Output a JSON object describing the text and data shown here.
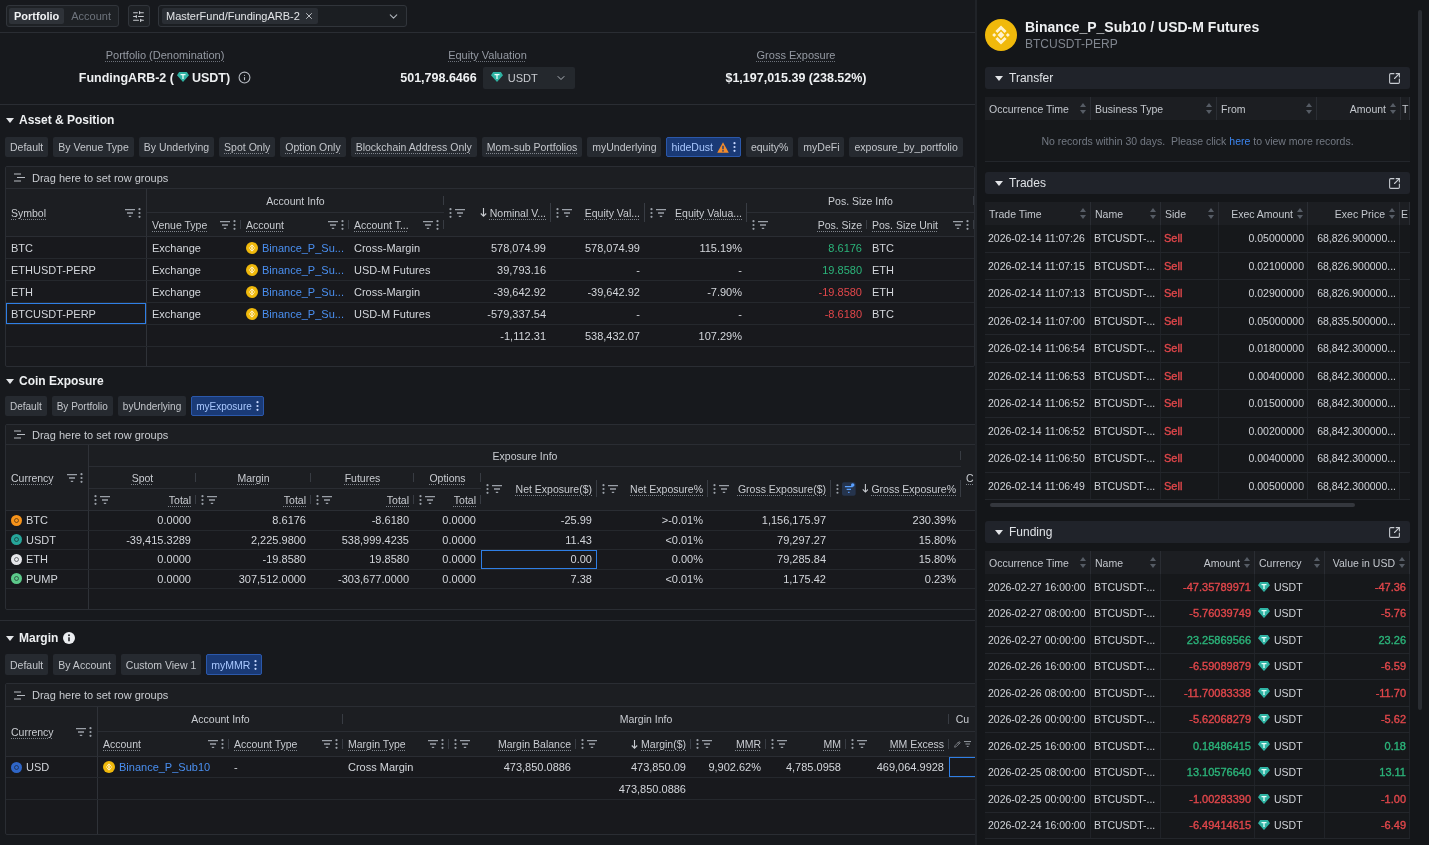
{
  "top_bar": {
    "scope_tabs": [
      {
        "label": "Portfolio",
        "selected": true
      },
      {
        "label": "Account",
        "selected": false
      }
    ],
    "portfolio_chips": [
      "MasterFund/FundingARB-2"
    ]
  },
  "summary": [
    {
      "kind": "denomination",
      "label": "Portfolio (Denomination)",
      "value": "FundingARB-2 (",
      "currency": "USDT)"
    },
    {
      "kind": "valuation",
      "label": "Equity Valuation",
      "value": "501,798.6466",
      "currency": "USDT"
    },
    {
      "kind": "plain",
      "label": "Gross Exposure",
      "value": "$1,197,015.39 (238.52%)"
    }
  ],
  "sections": [
    {
      "title": "Asset & Position",
      "expanded": true,
      "views": [
        {
          "label": "Default",
          "selected": false,
          "hint": false,
          "warning": false
        },
        {
          "label": "By Venue Type",
          "selected": false,
          "hint": false,
          "warning": false
        },
        {
          "label": "By Underlying",
          "selected": false,
          "hint": false,
          "warning": false
        },
        {
          "label": "Spot Only",
          "selected": false,
          "hint": true,
          "warning": false
        },
        {
          "label": "Option Only",
          "selected": false,
          "hint": true,
          "warning": false
        },
        {
          "label": "Blockchain Address Only",
          "selected": false,
          "hint": true,
          "warning": false
        },
        {
          "label": "Mom-sub Portfolios",
          "selected": false,
          "hint": true,
          "warning": false
        },
        {
          "label": "myUnderlying",
          "selected": false,
          "hint": false,
          "warning": false
        },
        {
          "label": "hideDust",
          "selected": true,
          "hint": false,
          "warning": true
        },
        {
          "label": "equity%",
          "selected": false,
          "hint": false,
          "warning": false
        },
        {
          "label": "myDeFi",
          "selected": false,
          "hint": false,
          "warning": false
        },
        {
          "label": "exposure_by_portfolio",
          "selected": false,
          "hint": false,
          "warning": false
        }
      ],
      "grid": {
        "group_bar": "Drag here to set row groups",
        "header": [
          {
            "label": "Symbol",
            "kind": "text"
          },
          {
            "label": "Account Info",
            "children": [
              {
                "label": "Venue Type",
                "kind": "text"
              },
              {
                "label": "Account",
                "kind": "text"
              },
              {
                "label": "Account T...",
                "kind": "text"
              }
            ]
          },
          {
            "label": "Nominal V...",
            "kind": "number",
            "sort_descending": true,
            "total": "-1,112.31"
          },
          {
            "label": "Equity Val...",
            "kind": "number",
            "total": "538,432.07"
          },
          {
            "label": "Equity Valua...",
            "kind": "number",
            "total": "107.29%"
          },
          {
            "label": "Pos. Size Info",
            "children": [
              {
                "label": "Pos. Size",
                "kind": "number"
              },
              {
                "label": "Pos. Size Unit",
                "kind": "text"
              }
            ]
          }
        ],
        "rows": [
          [
            "BTC",
            "Exchange",
            {
              "text": "Binance_P_Su...",
              "kind": "account"
            },
            "Cross-Margin",
            "578,074.99",
            "578,074.99",
            "115.19%",
            {
              "text": "8.6176",
              "color": "#2bb47a"
            },
            "BTC"
          ],
          [
            "ETHUSDT-PERP",
            "Exchange",
            {
              "text": "Binance_P_Su...",
              "kind": "account"
            },
            "USD-M Futures",
            "39,793.16",
            "-",
            "-",
            {
              "text": "19.8580",
              "color": "#2bb47a"
            },
            "ETH"
          ],
          [
            "ETH",
            "Exchange",
            {
              "text": "Binance_P_Su...",
              "kind": "account"
            },
            "Cross-Margin",
            "-39,642.92",
            "-39,642.92",
            "-7.90%",
            {
              "text": "-19.8580",
              "color": "#e2474b"
            },
            "ETH"
          ],
          [
            {
              "text": "BTCUSDT-PERP",
              "focused": true
            },
            "Exchange",
            {
              "text": "Binance_P_Su...",
              "kind": "account"
            },
            "USD-M Futures",
            "-579,337.54",
            "-",
            "-",
            {
              "text": "-8.6180",
              "color": "#e2474b"
            },
            "BTC"
          ]
        ]
      }
    },
    {
      "title": "Coin Exposure",
      "expanded": true,
      "views": [
        {
          "label": "Default",
          "selected": false,
          "hint": false,
          "warning": false
        },
        {
          "label": "By Portfolio",
          "selected": false,
          "hint": false,
          "warning": false
        },
        {
          "label": "byUnderlying",
          "selected": false,
          "hint": false,
          "warning": false
        },
        {
          "label": "myExposure",
          "selected": true,
          "hint": false,
          "warning": false
        }
      ],
      "grid": {
        "group_bar": "Drag here to set row groups",
        "header": [
          {
            "label": "Currency",
            "kind": "text"
          },
          {
            "label": "Exposure Info",
            "children": [
              {
                "label": "Spot",
                "hint": true,
                "children": [
                  {
                    "label": "Total",
                    "kind": "number"
                  }
                ]
              },
              {
                "label": "Margin",
                "hint": true,
                "children": [
                  {
                    "label": "Total",
                    "kind": "number"
                  }
                ]
              },
              {
                "label": "Futures",
                "hint": true,
                "children": [
                  {
                    "label": "Total",
                    "kind": "number"
                  }
                ]
              },
              {
                "label": "Options",
                "hint": true,
                "children": [
                  {
                    "label": "Total",
                    "kind": "number"
                  }
                ]
              },
              {
                "label": "Net Exposure($)",
                "kind": "number"
              },
              {
                "label": "Net Exposure%",
                "kind": "number"
              },
              {
                "label": "Gross Exposure($)",
                "kind": "number"
              },
              {
                "label": "Gross Exposure%",
                "kind": "number",
                "sort_descending": true,
                "filtered": true
              }
            ]
          },
          {
            "label": "C",
            "kind": "cut"
          }
        ],
        "rows": [
          [
            {
              "text": "BTC",
              "kind": "coin",
              "color": "#f7931a"
            },
            "0.0000",
            "8.6176",
            "-8.6180",
            "0.0000",
            "-25.99",
            ">-0.01%",
            "1,156,175.97",
            "230.39%"
          ],
          [
            {
              "text": "USDT",
              "kind": "coin",
              "color": "#26a69a"
            },
            "-39,415.3289",
            "2,225.9800",
            "538,999.4235",
            "0.0000",
            "11.43",
            "<0.01%",
            "79,297.27",
            "15.80%"
          ],
          [
            {
              "text": "ETH",
              "kind": "coin",
              "color": "#e6e7ea"
            },
            "0.0000",
            "-19.8580",
            "19.8580",
            "0.0000",
            {
              "text": "0.00",
              "focused": true
            },
            "0.00%",
            "79,285.84",
            "15.80%"
          ],
          [
            {
              "text": "PUMP",
              "kind": "coin",
              "color": "#5cc98a"
            },
            "0.0000",
            "307,512.0000",
            "-303,677.0000",
            "0.0000",
            "7.38",
            "<0.01%",
            "1,175.42",
            "0.23%"
          ]
        ]
      }
    },
    {
      "title": "Margin",
      "expanded": true,
      "info": true,
      "views": [
        {
          "label": "Default",
          "selected": false,
          "hint": false,
          "warning": false
        },
        {
          "label": "By Account",
          "selected": false,
          "hint": false,
          "warning": false
        },
        {
          "label": "Custom View 1",
          "selected": false,
          "hint": false,
          "warning": false
        },
        {
          "label": "myMMR",
          "selected": true,
          "hint": false,
          "warning": false
        }
      ],
      "grid": {
        "group_bar": "Drag here to set row groups",
        "header": [
          {
            "label": "Currency",
            "kind": "text"
          },
          {
            "label": "Account Info",
            "children": [
              {
                "label": "Account",
                "kind": "text"
              },
              {
                "label": "Account Type",
                "kind": "text"
              }
            ]
          },
          {
            "label": "Margin Info",
            "children": [
              {
                "label": "Margin Type",
                "kind": "text"
              },
              {
                "label": "Margin Balance",
                "kind": "number"
              },
              {
                "label": "Margin($)",
                "kind": "number",
                "sort_descending": true,
                "total": "473,850.0886"
              },
              {
                "label": "MMR",
                "kind": "number"
              },
              {
                "label": "MM",
                "kind": "number"
              },
              {
                "label": "MM Excess",
                "kind": "number"
              }
            ]
          },
          {
            "label": "Cu",
            "children": [
              {
                "kind": "edit"
              }
            ]
          }
        ],
        "rows": [
          [
            {
              "text": "USD",
              "kind": "coin",
              "color": "#2f66c8"
            },
            {
              "text": "Binance_P_Sub10",
              "kind": "account"
            },
            "-",
            "Cross Margin",
            "473,850.0886",
            "473,850.09",
            "9,902.62%",
            "4,785.0958",
            "469,064.9928",
            {
              "focused": true
            }
          ]
        ]
      }
    }
  ],
  "detail": {
    "title": "Binance_P_Sub10 / USD-M Futures",
    "subtitle": "BTCUSDT-PERP",
    "panels": [
      {
        "title": "Transfer",
        "expanded": true,
        "columns": [
          {
            "label": "Occurrence Time",
            "kind": "text"
          },
          {
            "label": "Business Type",
            "kind": "text"
          },
          {
            "label": "From",
            "kind": "text"
          },
          {
            "label": "Amount",
            "kind": "number"
          },
          {
            "label": "T",
            "kind": "cut"
          }
        ],
        "empty": {
          "before": "No records within 30 days.  Please click ",
          "link": "here",
          "after": " to view more records."
        }
      },
      {
        "title": "Trades",
        "expanded": true,
        "columns": [
          {
            "label": "Trade Time",
            "kind": "text"
          },
          {
            "label": "Name",
            "kind": "text"
          },
          {
            "label": "Side",
            "kind": "text"
          },
          {
            "label": "Exec Amount",
            "kind": "number"
          },
          {
            "label": "Exec Price",
            "kind": "number"
          },
          {
            "label": "E",
            "kind": "cut"
          }
        ],
        "rows": [
          [
            "2026-02-14 11:07:26",
            "BTCUSDT-...",
            {
              "text": "Sell",
              "color": "#e2474b"
            },
            "0.05000000",
            "68,826.900000..."
          ],
          [
            "2026-02-14 11:07:15",
            "BTCUSDT-...",
            {
              "text": "Sell",
              "color": "#e2474b"
            },
            "0.02100000",
            "68,826.900000..."
          ],
          [
            "2026-02-14 11:07:13",
            "BTCUSDT-...",
            {
              "text": "Sell",
              "color": "#e2474b"
            },
            "0.02900000",
            "68,826.900000..."
          ],
          [
            "2026-02-14 11:07:00",
            "BTCUSDT-...",
            {
              "text": "Sell",
              "color": "#e2474b"
            },
            "0.05000000",
            "68,835.500000..."
          ],
          [
            "2026-02-14 11:06:54",
            "BTCUSDT-...",
            {
              "text": "Sell",
              "color": "#e2474b"
            },
            "0.01800000",
            "68,842.300000..."
          ],
          [
            "2026-02-14 11:06:53",
            "BTCUSDT-...",
            {
              "text": "Sell",
              "color": "#e2474b"
            },
            "0.00400000",
            "68,842.300000..."
          ],
          [
            "2026-02-14 11:06:52",
            "BTCUSDT-...",
            {
              "text": "Sell",
              "color": "#e2474b"
            },
            "0.01500000",
            "68,842.300000..."
          ],
          [
            "2026-02-14 11:06:52",
            "BTCUSDT-...",
            {
              "text": "Sell",
              "color": "#e2474b"
            },
            "0.00200000",
            "68,842.300000..."
          ],
          [
            "2026-02-14 11:06:50",
            "BTCUSDT-...",
            {
              "text": "Sell",
              "color": "#e2474b"
            },
            "0.00400000",
            "68,842.300000..."
          ],
          [
            "2026-02-14 11:06:49",
            "BTCUSDT-...",
            {
              "text": "Sell",
              "color": "#e2474b"
            },
            "0.00500000",
            "68,842.300000..."
          ]
        ]
      },
      {
        "title": "Funding",
        "expanded": true,
        "columns": [
          {
            "label": "Occurrence Time",
            "kind": "text"
          },
          {
            "label": "Name",
            "kind": "text"
          },
          {
            "label": "Amount",
            "kind": "number"
          },
          {
            "label": "Currency",
            "kind": "text"
          },
          {
            "label": "Value in USD",
            "kind": "number"
          }
        ],
        "rows": [
          [
            "2026-02-27 16:00:00",
            "BTCUSDT-...",
            {
              "text": "-47.35789971",
              "color": "#e2474b"
            },
            {
              "text": "USDT",
              "kind": "currency"
            },
            {
              "text": "-47.36",
              "color": "#e2474b"
            }
          ],
          [
            "2026-02-27 08:00:00",
            "BTCUSDT-...",
            {
              "text": "-5.76039749",
              "color": "#e2474b"
            },
            {
              "text": "USDT",
              "kind": "currency"
            },
            {
              "text": "-5.76",
              "color": "#e2474b"
            }
          ],
          [
            "2026-02-27 00:00:00",
            "BTCUSDT-...",
            {
              "text": "23.25869566",
              "color": "#2bb47a"
            },
            {
              "text": "USDT",
              "kind": "currency"
            },
            {
              "text": "23.26",
              "color": "#2bb47a"
            }
          ],
          [
            "2026-02-26 16:00:00",
            "BTCUSDT-...",
            {
              "text": "-6.59089879",
              "color": "#e2474b"
            },
            {
              "text": "USDT",
              "kind": "currency"
            },
            {
              "text": "-6.59",
              "color": "#e2474b"
            }
          ],
          [
            "2026-02-26 08:00:00",
            "BTCUSDT-...",
            {
              "text": "-11.70083338",
              "color": "#e2474b"
            },
            {
              "text": "USDT",
              "kind": "currency"
            },
            {
              "text": "-11.70",
              "color": "#e2474b"
            }
          ],
          [
            "2026-02-26 00:00:00",
            "BTCUSDT-...",
            {
              "text": "-5.62068279",
              "color": "#e2474b"
            },
            {
              "text": "USDT",
              "kind": "currency"
            },
            {
              "text": "-5.62",
              "color": "#e2474b"
            }
          ],
          [
            "2026-02-25 16:00:00",
            "BTCUSDT-...",
            {
              "text": "0.18486415",
              "color": "#2bb47a"
            },
            {
              "text": "USDT",
              "kind": "currency"
            },
            {
              "text": "0.18",
              "color": "#2bb47a"
            }
          ],
          [
            "2026-02-25 08:00:00",
            "BTCUSDT-...",
            {
              "text": "13.10576640",
              "color": "#2bb47a"
            },
            {
              "text": "USDT",
              "kind": "currency"
            },
            {
              "text": "13.11",
              "color": "#2bb47a"
            }
          ],
          [
            "2026-02-25 00:00:00",
            "BTCUSDT-...",
            {
              "text": "-1.00283390",
              "color": "#e2474b"
            },
            {
              "text": "USDT",
              "kind": "currency"
            },
            {
              "text": "-1.00",
              "color": "#e2474b"
            }
          ],
          [
            "2026-02-24 16:00:00",
            "BTCUSDT-...",
            {
              "text": "-6.49414615",
              "color": "#e2474b"
            },
            {
              "text": "USDT",
              "kind": "currency"
            },
            {
              "text": "-6.49",
              "color": "#e2474b"
            }
          ]
        ]
      }
    ]
  }
}
